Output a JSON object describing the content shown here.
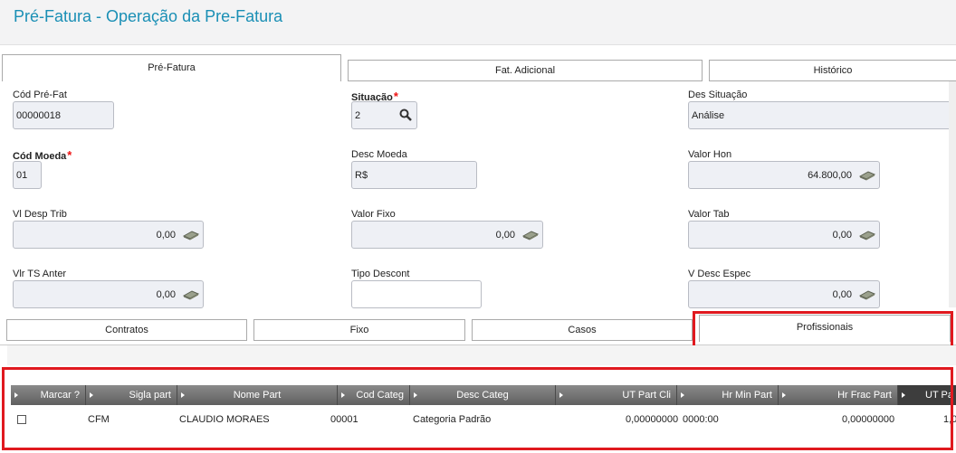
{
  "header": {
    "title": "Pré-Fatura - Operação da Pre-Fatura"
  },
  "top_tabs": [
    {
      "label": "Pré-Fatura",
      "active": true
    },
    {
      "label": "Fat. Adicional",
      "active": false
    },
    {
      "label": "Histórico",
      "active": false
    }
  ],
  "form": {
    "cod_pre_fat": {
      "label": "Cód Pré-Fat",
      "value": "00000018"
    },
    "situacao": {
      "label": "Situação",
      "required": "*",
      "value": "2"
    },
    "des_situacao": {
      "label": "Des Situação",
      "value": "Análise"
    },
    "cod_moeda": {
      "label": "Cód Moeda",
      "required": "*",
      "value": "01"
    },
    "desc_moeda": {
      "label": "Desc Moeda",
      "value": "R$"
    },
    "valor_hon": {
      "label": "Valor Hon",
      "value": "64.800,00"
    },
    "vl_desp_trib": {
      "label": "Vl Desp Trib",
      "value": "0,00"
    },
    "valor_fixo": {
      "label": "Valor Fixo",
      "value": "0,00"
    },
    "valor_tab": {
      "label": "Valor Tab",
      "value": "0,00"
    },
    "vlr_ts_anter": {
      "label": "Vlr TS Anter",
      "value": "0,00"
    },
    "tipo_descont": {
      "label": "Tipo Descont",
      "value": ""
    },
    "v_desc_espec": {
      "label": "V Desc Espec",
      "value": "0,00"
    }
  },
  "bottom_tabs": [
    {
      "label": "Contratos",
      "active": false
    },
    {
      "label": "Fixo",
      "active": false
    },
    {
      "label": "Casos",
      "active": false
    },
    {
      "label": "Profissionais",
      "active": true
    }
  ],
  "grid": {
    "columns": [
      "Marcar ?",
      "Sigla part",
      "Nome Part",
      "Cod Categ",
      "Desc Categ",
      "UT Part Cli",
      "Hr Min Part",
      "Hr Frac Part",
      "UT Pa"
    ],
    "rows": [
      {
        "sigla": "CFM",
        "nome": "CLAUDIO MORAES",
        "cod_categ": "00001",
        "desc_categ": "Categoria Padrão",
        "ut_part_cli": "0,00000000",
        "hr_min_part": "0000:00",
        "hr_frac_part": "0,00000000",
        "ut_pa": "1,0"
      }
    ]
  },
  "icons": {
    "money": "money-icon",
    "search": "search-icon"
  },
  "colors": {
    "title": "#1a8fb5",
    "highlight": "#e0191f",
    "required": "#e11111"
  }
}
